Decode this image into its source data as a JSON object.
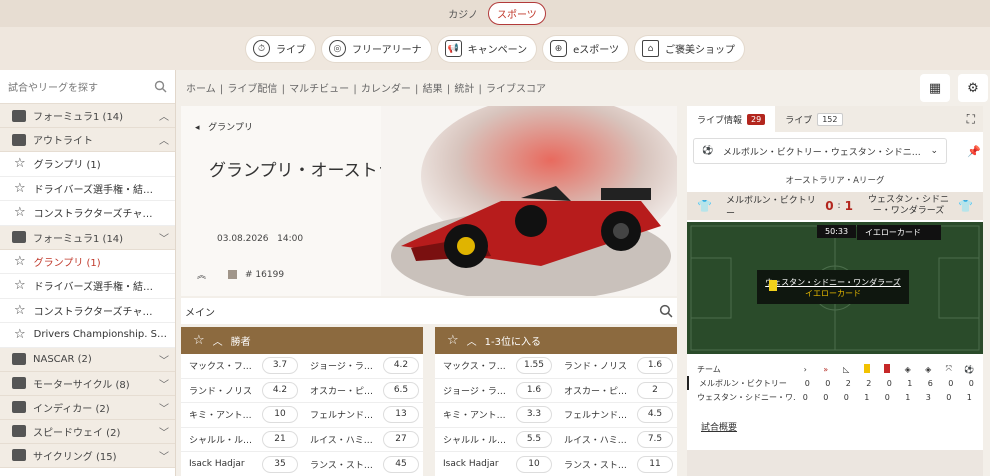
{
  "topnav": {
    "tabs": [
      {
        "label": "カジノ"
      },
      {
        "label": "スポーツ",
        "active": true
      }
    ]
  },
  "mainnav": {
    "buttons": [
      {
        "label": "ライブ",
        "icon": "stopwatch-icon"
      },
      {
        "label": "フリーアリーナ",
        "icon": "target-icon"
      },
      {
        "label": "キャンペーン",
        "icon": "megaphone-icon"
      },
      {
        "label": "eスポーツ",
        "icon": "gamepad-icon"
      },
      {
        "label": "ご褒美ショップ",
        "icon": "shop-icon"
      }
    ]
  },
  "sidebar": {
    "search_placeholder": "試合やリーグを探す",
    "items": [
      {
        "type": "group",
        "label": "フォーミュラ1 (14)",
        "icon": "f1-icon",
        "chev": "up"
      },
      {
        "type": "group",
        "label": "アウトライト",
        "icon": "podium-icon",
        "chev": "up"
      },
      {
        "type": "item",
        "label": "グランプリ (1)"
      },
      {
        "type": "item",
        "label": "ドライバーズ選手権・結…"
      },
      {
        "type": "item",
        "label": "コンストラクターズチャ…"
      },
      {
        "type": "group",
        "label": "フォーミュラ1 (14)",
        "icon": "world-icon",
        "chev": "down"
      },
      {
        "type": "item",
        "label": "グランプリ (1)",
        "active": true
      },
      {
        "type": "item",
        "label": "ドライバーズ選手権・結…"
      },
      {
        "type": "item",
        "label": "コンストラクターズチャ…"
      },
      {
        "type": "item",
        "label": "Drivers Championship. S…"
      },
      {
        "type": "group",
        "label": "NASCAR (2)",
        "icon": "nascar-icon",
        "chev": "down"
      },
      {
        "type": "group",
        "label": "モーターサイクル (8)",
        "icon": "helmet-icon",
        "chev": "down"
      },
      {
        "type": "group",
        "label": "インディカー (2)",
        "icon": "indycar-icon",
        "chev": "down"
      },
      {
        "type": "group",
        "label": "スピードウェイ (2)",
        "icon": "motorbike-icon",
        "chev": "down"
      },
      {
        "type": "group",
        "label": "サイクリング (15)",
        "icon": "bicycle-icon",
        "chev": "down"
      }
    ]
  },
  "breadcrumbs": "ホーム | ライブ配信 | マルチビュー | カレンダー | 結果 | 統計 | ライブスコア",
  "hero": {
    "back_label": "グランプリ",
    "title": "グランプリ・オーストラリア",
    "date": "03.08.2026",
    "time": "14:00",
    "event_id": "# 16199"
  },
  "main_label": "メイン",
  "markets": [
    {
      "title": "勝者",
      "rows": [
        [
          {
            "name": "マックス・フ…",
            "odd": "3.7"
          },
          {
            "name": "ジョージ・ラ…",
            "odd": "4.2"
          }
        ],
        [
          {
            "name": "ランド・ノリス",
            "odd": "4.2"
          },
          {
            "name": "オスカー・ピ…",
            "odd": "6.5"
          }
        ],
        [
          {
            "name": "キミ・アント…",
            "odd": "10"
          },
          {
            "name": "フェルナンド…",
            "odd": "13"
          }
        ],
        [
          {
            "name": "シャルル・ル…",
            "odd": "21"
          },
          {
            "name": "ルイス・ハミ…",
            "odd": "27"
          }
        ],
        [
          {
            "name": "Isack Hadjar",
            "odd": "35"
          },
          {
            "name": "ランス・スト…",
            "odd": "45"
          }
        ]
      ]
    },
    {
      "title": "1-3位に入る",
      "rows": [
        [
          {
            "name": "マックス・フ…",
            "odd": "1.55"
          },
          {
            "name": "ランド・ノリス",
            "odd": "1.6"
          }
        ],
        [
          {
            "name": "ジョージ・ラ…",
            "odd": "1.6"
          },
          {
            "name": "オスカー・ピ…",
            "odd": "2"
          }
        ],
        [
          {
            "name": "キミ・アント…",
            "odd": "3.3"
          },
          {
            "name": "フェルナンド…",
            "odd": "4.5"
          }
        ],
        [
          {
            "name": "シャルル・ル…",
            "odd": "5.5"
          },
          {
            "name": "ルイス・ハミ…",
            "odd": "7.5"
          }
        ],
        [
          {
            "name": "Isack Hadjar",
            "odd": "10"
          },
          {
            "name": "ランス・スト…",
            "odd": "11"
          }
        ]
      ]
    }
  ],
  "right": {
    "tabs": [
      {
        "label": "ライブ情報",
        "count": "29"
      },
      {
        "label": "ライブ",
        "count": "152"
      }
    ],
    "match_select": "メルボルン・ビクトリー・ウェスタン・シドニ…",
    "league": "オーストラリア・Aリーグ",
    "home": "メルボルン・ビクトリー",
    "away": "ウェスタン・シドニー・ワンダラーズ",
    "score_home": "0",
    "score_away": "1",
    "clock": "50:33",
    "event_label": "イエローカード",
    "event_team": "ウェスタン・シドニー・ワンダラーズ",
    "event_type": "イエローカード",
    "stats_header": "チーム",
    "stats": [
      {
        "team": "メルボルン・ビクトリー",
        "values": [
          "0",
          "0",
          "2",
          "2",
          "0",
          "1",
          "6",
          "0",
          "0"
        ]
      },
      {
        "team": "ウェスタン・シドニー・ワ…",
        "values": [
          "0",
          "0",
          "0",
          "1",
          "0",
          "1",
          "3",
          "0",
          "1"
        ]
      }
    ],
    "summary": "試合概要"
  }
}
